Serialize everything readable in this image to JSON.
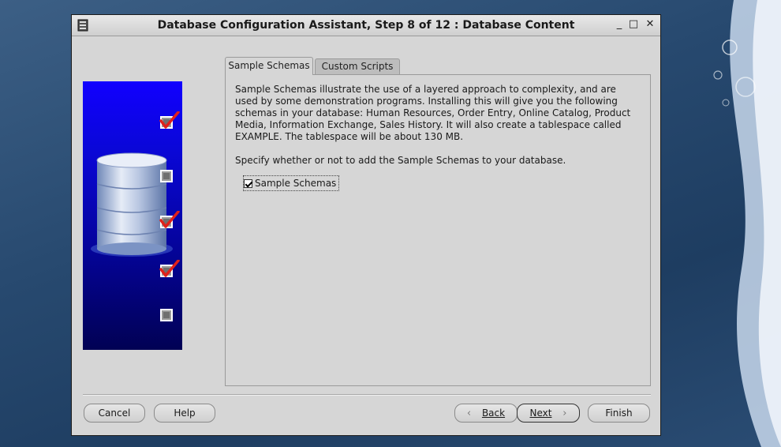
{
  "window": {
    "title": "Database Configuration Assistant, Step 8 of 12 : Database Content",
    "controls": {
      "minimize": "_",
      "maximize": "□",
      "close": "✕"
    }
  },
  "side_panel": {
    "steps": [
      {
        "state": "checked"
      },
      {
        "state": "unchecked"
      },
      {
        "state": "checked"
      },
      {
        "state": "checked"
      },
      {
        "state": "unchecked"
      }
    ]
  },
  "tabs": [
    {
      "label": "Sample Schemas",
      "active": true
    },
    {
      "label": "Custom Scripts",
      "active": false
    }
  ],
  "content": {
    "description": "Sample Schemas illustrate the use of a layered approach to complexity, and are used by some demonstration programs. Installing this will give you the following schemas in your database: Human Resources, Order Entry, Online Catalog, Product Media, Information Exchange, Sales History. It will also create a tablespace called EXAMPLE. The tablespace will be about 130 MB.",
    "prompt": "Specify whether or not to add the Sample Schemas to your database.",
    "checkbox": {
      "label": "Sample Schemas",
      "checked": true
    }
  },
  "buttons": {
    "cancel": "Cancel",
    "help": "Help",
    "back": "Back",
    "next": "Next",
    "finish": "Finish"
  },
  "colors": {
    "window_bg": "#d6d6d6",
    "side_panel_top": "#1100ff",
    "side_panel_bottom": "#010154",
    "check_mark": "#e0201a"
  }
}
